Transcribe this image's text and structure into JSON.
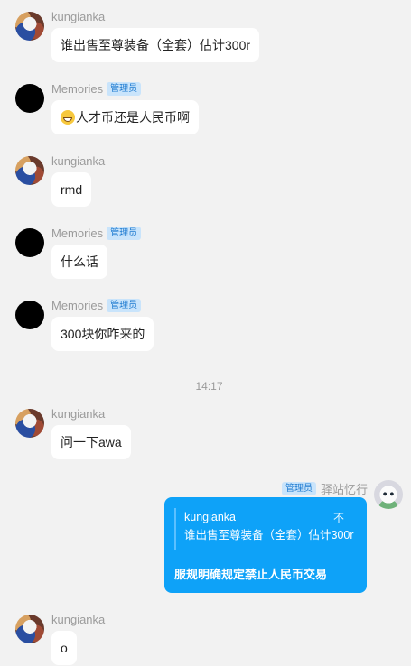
{
  "messages": [
    {
      "sender": "kungianka",
      "text": "谁出售至尊装备（全套）估计300r",
      "avatar": "owl-avatar"
    },
    {
      "sender": "Memories",
      "role": "管理员",
      "text": "人才币还是人民币啊",
      "emoji": "grinning-face",
      "avatar": "black-avatar"
    },
    {
      "sender": "kungianka",
      "text": "rmd",
      "avatar": "owl-avatar"
    },
    {
      "sender": "Memories",
      "role": "管理员",
      "text": "什么话",
      "avatar": "black-avatar"
    },
    {
      "sender": "Memories",
      "role": "管理员",
      "text": "300块你咋来的",
      "avatar": "black-avatar"
    },
    {
      "sender": "kungianka",
      "text": "问一下awa",
      "avatar": "owl-avatar"
    },
    {
      "sender": "kungianka",
      "text": "o",
      "avatar": "owl-avatar"
    }
  ],
  "timestamp": "14:17",
  "self_message": {
    "role": "管理员",
    "sender": "驿站忆行",
    "quote_sender": "kungianka",
    "quote_text": "谁出售至尊装备（全套）估计300r",
    "quote_icon": "不",
    "reply": "服规明确规定禁止人民币交易",
    "bubble_color": "#0ea2f8"
  },
  "colors": {
    "background": "#f2f2f2",
    "badge_bg": "#c9e4fb",
    "badge_text": "#1f7bd0"
  }
}
